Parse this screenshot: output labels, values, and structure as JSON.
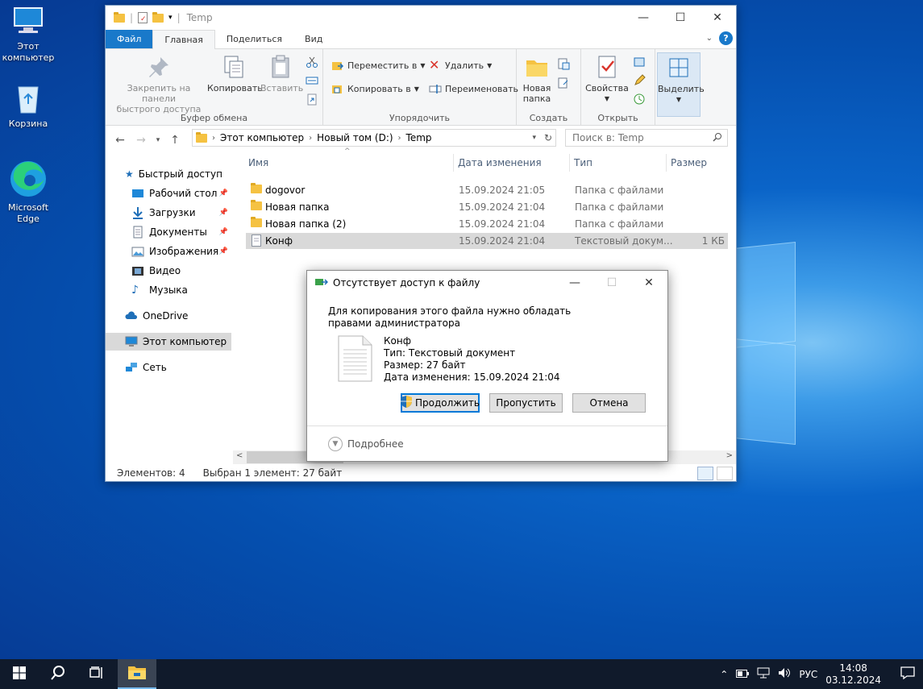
{
  "desktop": {
    "icons": [
      {
        "label": "Этот компьютер",
        "icon": "computer-icon"
      },
      {
        "label": "Корзина",
        "icon": "recycle-bin-icon"
      },
      {
        "label": "Microsoft Edge",
        "icon": "edge-icon"
      }
    ]
  },
  "explorer": {
    "title": "Temp",
    "tabs": {
      "file": "Файл",
      "home": "Главная",
      "share": "Поделиться",
      "view": "Вид"
    },
    "ribbon": {
      "pin": "Закрепить на панели быстрого доступа",
      "pin_l1": "Закрепить на панели",
      "pin_l2": "быстрого доступа",
      "copy": "Копировать",
      "paste": "Вставить",
      "clipboard_group": "Буфер обмена",
      "move_to": "Переместить в",
      "copy_to": "Копировать в",
      "delete": "Удалить",
      "rename": "Переименовать",
      "organize_group": "Упорядочить",
      "new_folder_l1": "Новая",
      "new_folder_l2": "папка",
      "create_group": "Создать",
      "properties": "Свойства",
      "open_group": "Открыть",
      "select": "Выделить"
    },
    "address": {
      "crumbs": [
        "Этот компьютер",
        "Новый том (D:)",
        "Temp"
      ]
    },
    "search": {
      "placeholder": "Поиск в: Temp"
    },
    "nav": {
      "quick_access": "Быстрый доступ",
      "desktop": "Рабочий стол",
      "downloads": "Загрузки",
      "documents": "Документы",
      "pictures": "Изображения",
      "video": "Видео",
      "music": "Музыка",
      "onedrive": "OneDrive",
      "this_pc": "Этот компьютер",
      "network": "Сеть"
    },
    "columns": {
      "name": "Имя",
      "date": "Дата изменения",
      "type": "Тип",
      "size": "Размер"
    },
    "files": [
      {
        "name": "dogovor",
        "date": "15.09.2024 21:05",
        "type": "Папка с файлами",
        "size": ""
      },
      {
        "name": "Новая папка",
        "date": "15.09.2024 21:04",
        "type": "Папка с файлами",
        "size": ""
      },
      {
        "name": "Новая папка (2)",
        "date": "15.09.2024 21:04",
        "type": "Папка с файлами",
        "size": ""
      },
      {
        "name": "Конф",
        "date": "15.09.2024 21:04",
        "type": "Текстовый докум...",
        "size": "1 КБ"
      }
    ],
    "status": {
      "count": "Элементов: 4",
      "selected": "Выбран 1 элемент: 27 байт"
    }
  },
  "dialog": {
    "title": "Отсутствует доступ к файлу",
    "message": "Для копирования этого файла нужно обладать правами администратора",
    "file_name": "Конф",
    "file_type": "Тип: Текстовый документ",
    "file_size": "Размер: 27 байт",
    "file_date": "Дата изменения: 15.09.2024 21:04",
    "btn_continue": "Продолжить",
    "btn_skip": "Пропустить",
    "btn_cancel": "Отмена",
    "details": "Подробнее"
  },
  "taskbar": {
    "lang": "РУС",
    "time": "14:08",
    "date": "03.12.2024"
  },
  "colors": {
    "accent": "#1979ca",
    "taskbar": "#101a2b"
  }
}
